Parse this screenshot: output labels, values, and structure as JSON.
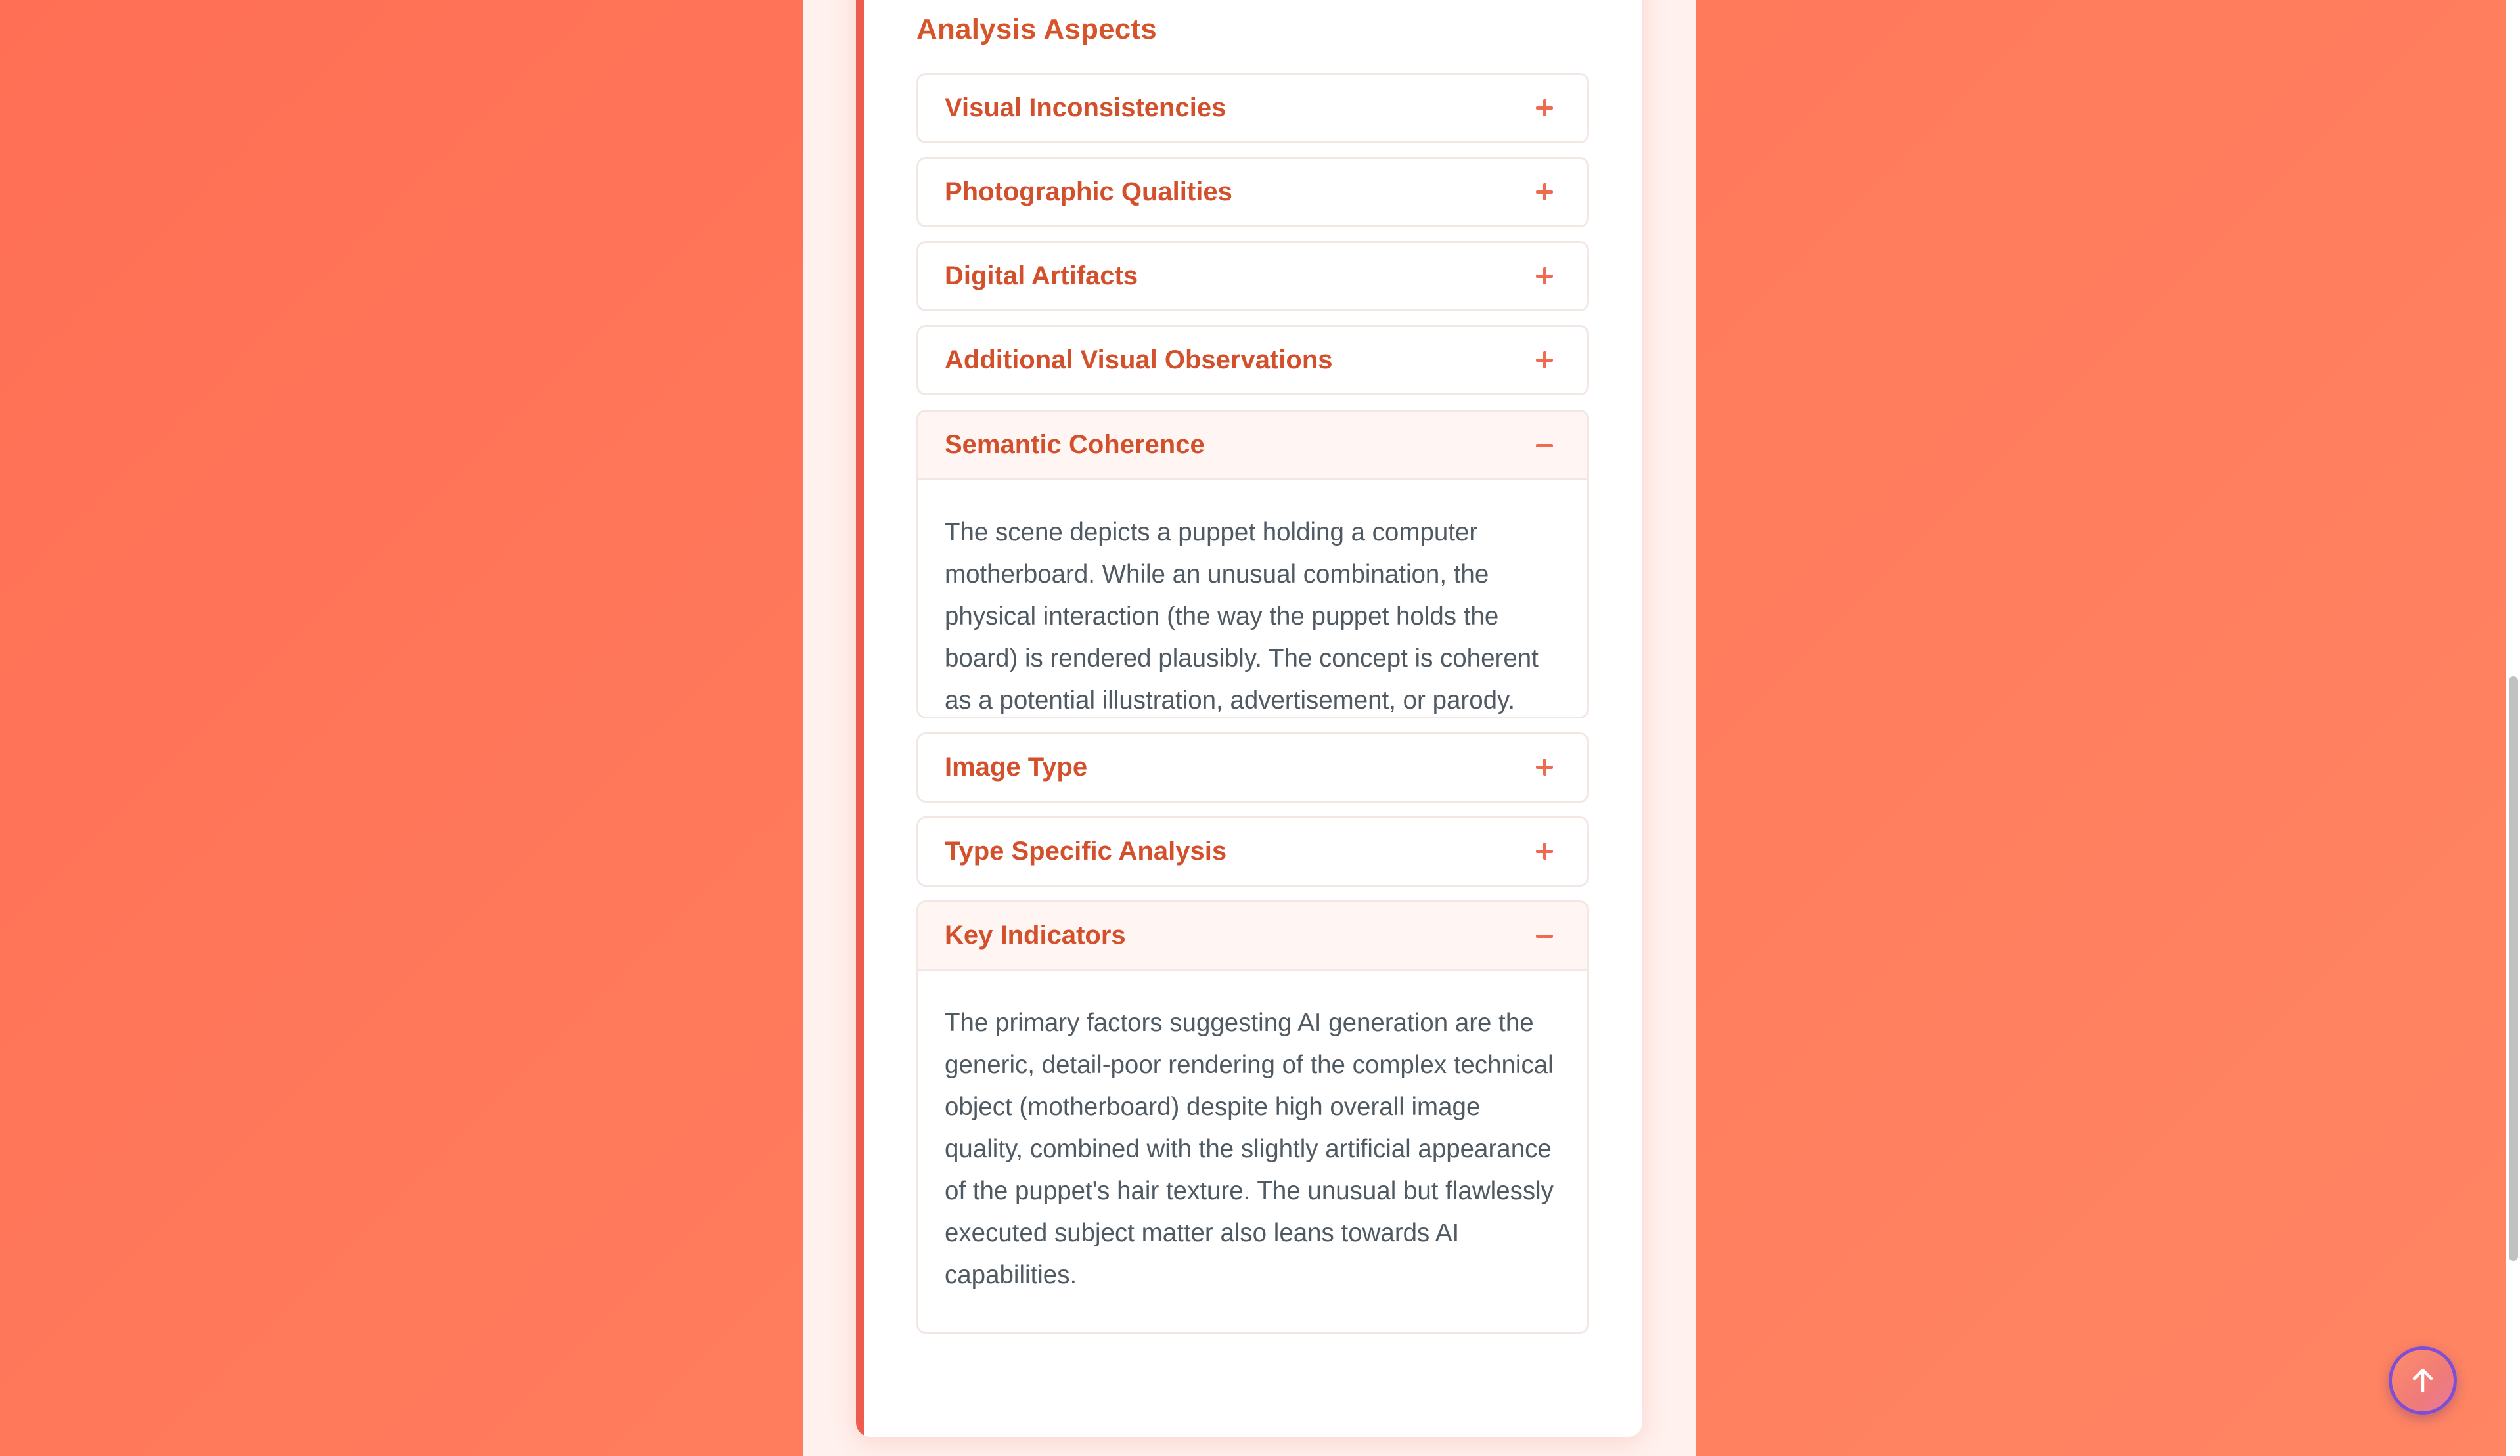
{
  "section": {
    "title": "Analysis Aspects"
  },
  "accordions": [
    {
      "title": "Visual Inconsistencies",
      "expanded": false,
      "content": ""
    },
    {
      "title": "Photographic Qualities",
      "expanded": false,
      "content": ""
    },
    {
      "title": "Digital Artifacts",
      "expanded": false,
      "content": ""
    },
    {
      "title": "Additional Visual Observations",
      "expanded": false,
      "content": ""
    },
    {
      "title": "Semantic Coherence",
      "expanded": true,
      "content": "The scene depicts a puppet holding a computer motherboard. While an unusual combination, the physical interaction (the way the puppet holds the board) is rendered plausibly. The concept is coherent as a potential illustration, advertisement, or parody."
    },
    {
      "title": "Image Type",
      "expanded": false,
      "content": ""
    },
    {
      "title": "Type Specific Analysis",
      "expanded": false,
      "content": ""
    },
    {
      "title": "Key Indicators",
      "expanded": true,
      "content": "The primary factors suggesting AI generation are the generic, detail-poor rendering of the complex technical object (motherboard) despite high overall image quality, combined with the slightly artificial appearance of the puppet's hair texture. The unusual but flawlessly executed subject matter also leans towards AI capabilities."
    }
  ],
  "icons": {
    "expand": "plus-icon",
    "collapse": "minus-icon",
    "scroll_top": "arrow-up-icon"
  },
  "colors": {
    "background": "#ff7b5c",
    "accent": "#ee5c4d",
    "heading": "#d7542a",
    "body_text": "#505a63",
    "scroll_button_border": "#7c4fd6"
  }
}
